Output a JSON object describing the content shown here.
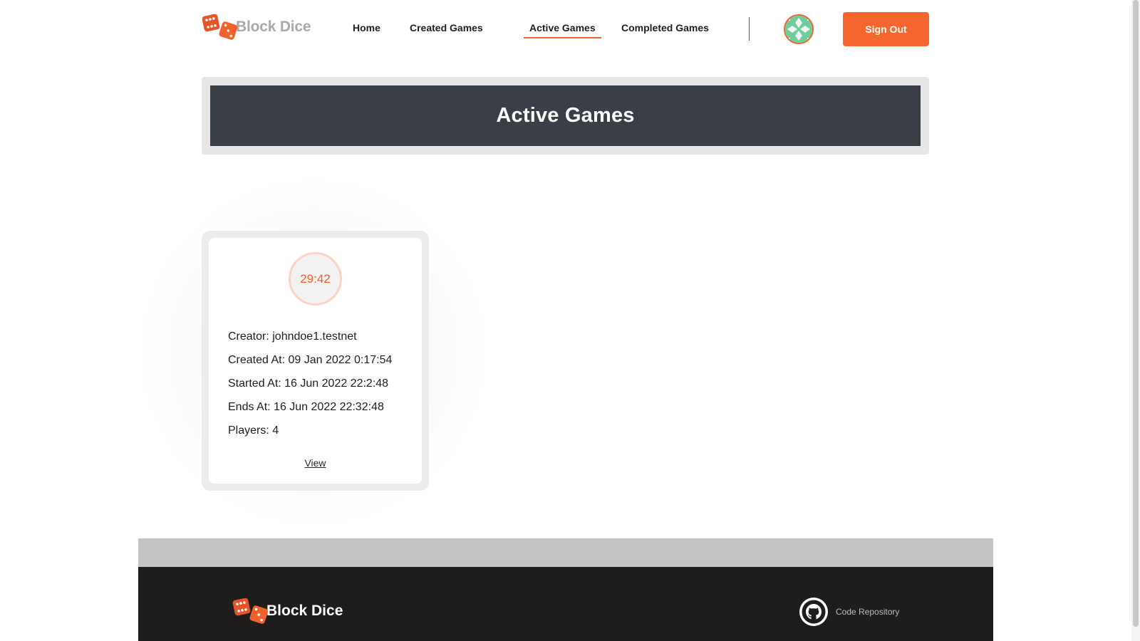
{
  "brand": {
    "name": "Block Dice",
    "accent": "#f6662f"
  },
  "nav": {
    "items": [
      {
        "label": "Home"
      },
      {
        "label": "Created Games"
      },
      {
        "label": "Active Games"
      },
      {
        "label": "Completed Games"
      }
    ],
    "active": "Active Games",
    "sign_out_label": "Sign Out",
    "avatar_icon": "user-avatar-icon"
  },
  "banner": {
    "title": "Active Games"
  },
  "game_card": {
    "timer": "29:42",
    "creator": "Creator: johndoe1.testnet",
    "created_at": "Created At: 09 Jan 2022 0:17:54",
    "started_at": "Started At: 16 Jun 2022 22:2:48",
    "ends_at": "Ends At: 16 Jun 2022 22:32:48",
    "players": "Players: 4",
    "view_label": "View"
  },
  "footer": {
    "brand": "Block Dice",
    "repo_label": "Code Repository",
    "repo_icon": "github-icon"
  }
}
